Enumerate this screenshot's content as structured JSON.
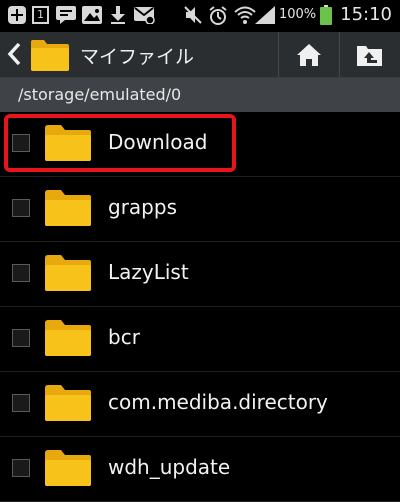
{
  "status_bar": {
    "icons": [
      "add-icon",
      "sim-1-icon",
      "sms-icon",
      "image-icon",
      "download-icon",
      "voicemail-icon",
      "mute-icon",
      "alarm-icon",
      "wifi-icon",
      "signal-icon",
      "battery-icon"
    ],
    "sim_badge": "1",
    "battery_percent": "100%",
    "time": "15:10"
  },
  "action_bar": {
    "title": "マイファイル",
    "back_icon": "chevron-left-icon",
    "folder_icon": "folder-icon",
    "home_icon": "home-icon",
    "up_icon": "folder-up-icon"
  },
  "path": "/storage/emulated/0",
  "files": [
    {
      "name": "Download",
      "icon": "folder-icon",
      "highlighted": true
    },
    {
      "name": "grapps",
      "icon": "folder-icon"
    },
    {
      "name": "LazyList",
      "icon": "folder-icon"
    },
    {
      "name": "bcr",
      "icon": "folder-icon"
    },
    {
      "name": "com.mediba.directory",
      "icon": "folder-icon"
    },
    {
      "name": "wdh_update",
      "icon": "folder-icon"
    }
  ],
  "colors": {
    "background": "#000000",
    "action_bar": "#2b2e31",
    "path_bar": "#3f4347",
    "folder": "#f7c21a",
    "highlight": "#e8141c",
    "battery": "#6cc24a"
  }
}
